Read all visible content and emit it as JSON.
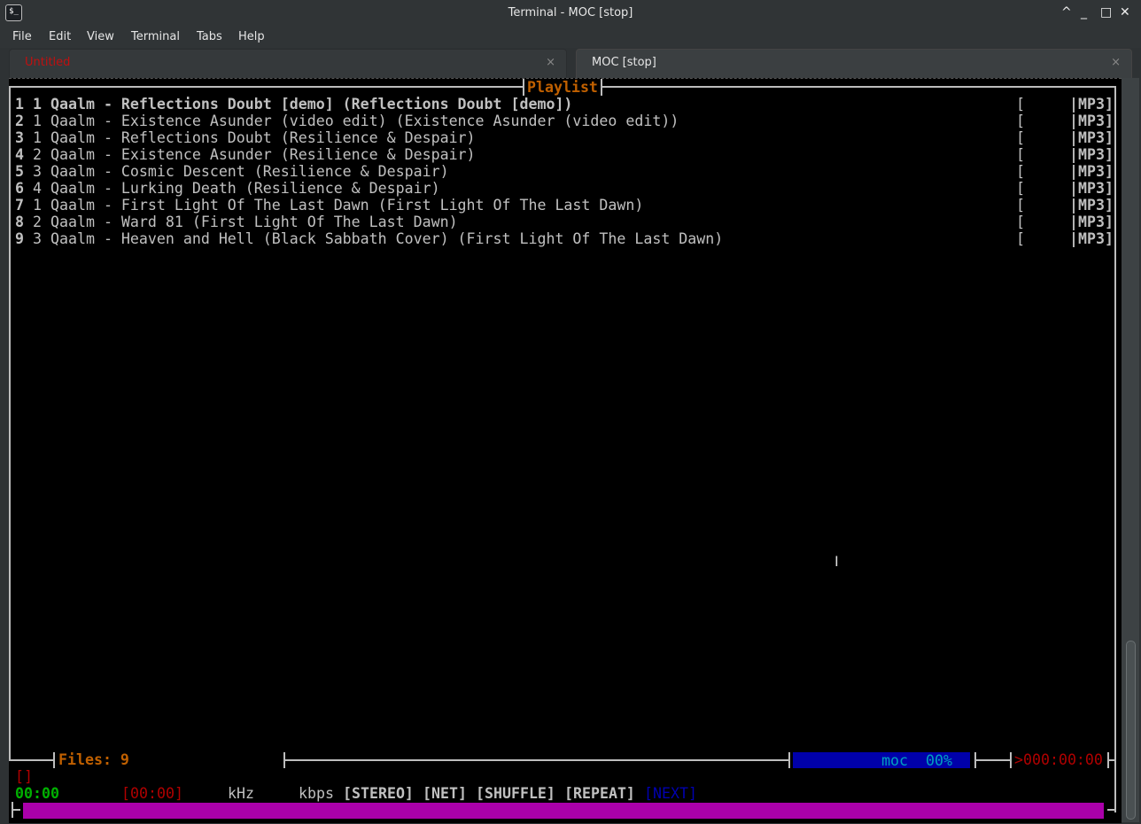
{
  "window": {
    "title": "Terminal - MOC [stop]",
    "icon": "terminal-icon",
    "controls": [
      "^",
      "_",
      "□",
      "✕"
    ]
  },
  "menu": [
    "File",
    "Edit",
    "View",
    "Terminal",
    "Tabs",
    "Help"
  ],
  "tabs": [
    {
      "label": "Untitled",
      "close": "×",
      "color": "#c01010"
    },
    {
      "label": "MOC [stop]",
      "close": "×"
    }
  ],
  "playlist": {
    "title": "Playlist",
    "rows": [
      {
        "num": "1",
        "track": "1",
        "text": "Qaalm - Reflections Doubt [demo] (Reflections Doubt [demo])",
        "time": "[      ",
        "fmt": "|MP3]",
        "bold": true
      },
      {
        "num": "2",
        "track": "1",
        "text": "Qaalm - Existence Asunder (video edit) (Existence Asunder (video edit))",
        "time": "[      ",
        "fmt": "|MP3]"
      },
      {
        "num": "3",
        "track": "1",
        "text": "Qaalm - Reflections Doubt (Resilience & Despair)",
        "time": "[      ",
        "fmt": "|MP3]"
      },
      {
        "num": "4",
        "track": "2",
        "text": "Qaalm - Existence Asunder (Resilience & Despair)",
        "time": "[      ",
        "fmt": "|MP3]"
      },
      {
        "num": "5",
        "track": "3",
        "text": "Qaalm - Cosmic Descent (Resilience & Despair)",
        "time": "[      ",
        "fmt": "|MP3]"
      },
      {
        "num": "6",
        "track": "4",
        "text": "Qaalm - Lurking Death (Resilience & Despair)",
        "time": "[      ",
        "fmt": "|MP3]"
      },
      {
        "num": "7",
        "track": "1",
        "text": "Qaalm - First Light Of The Last Dawn (First Light Of The Last Dawn)",
        "time": "[      ",
        "fmt": "|MP3]"
      },
      {
        "num": "8",
        "track": "2",
        "text": "Qaalm - Ward 81 (First Light Of The Last Dawn)",
        "time": "[      ",
        "fmt": "|MP3]"
      },
      {
        "num": "9",
        "track": "3",
        "text": "Qaalm - Heaven and Hell (Black Sabbath Cover) (First Light Of The Last Dawn)",
        "time": "[      ",
        "fmt": "|MP3]"
      }
    ]
  },
  "status": {
    "files": "Files: 9",
    "mixer": "moc  00%",
    "mixer_level": 0,
    "total_time": ">000:00:00",
    "title_line": "[]",
    "elapsed": "00:00",
    "duration": "[00:00]",
    "khz": "kHz",
    "kbps": "kbps",
    "stereo": "[STEREO]",
    "net": "[NET]",
    "shuffle": "[SHUFFLE]",
    "repeat": "[REPEAT]",
    "next": "[NEXT]",
    "progress": 0
  },
  "colors": {
    "accent": "#c06000",
    "mixer_bg": "#0000aa",
    "progress_bar": "#aa00aa",
    "red": "#b00000",
    "green": "#00b000",
    "blue": "#0000b0"
  }
}
